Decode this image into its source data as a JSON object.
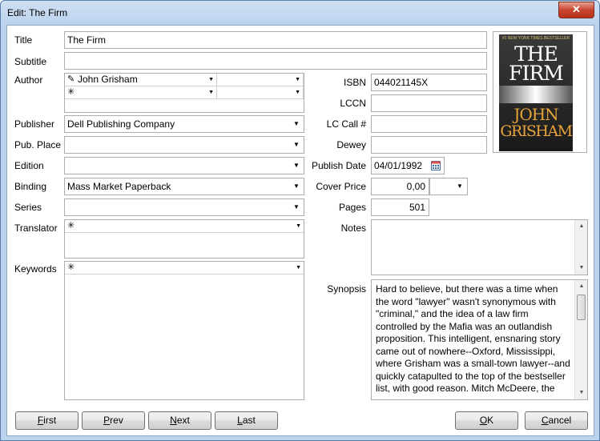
{
  "window": {
    "title": "Edit: The Firm",
    "close_glyph": "✕"
  },
  "labels": {
    "title": "Title",
    "subtitle": "Subtitle",
    "author": "Author",
    "publisher": "Publisher",
    "pub_place": "Pub. Place",
    "edition": "Edition",
    "binding": "Binding",
    "series": "Series",
    "translator": "Translator",
    "keywords": "Keywords",
    "isbn": "ISBN",
    "lccn": "LCCN",
    "lc_call": "LC Call #",
    "dewey": "Dewey",
    "publish_date": "Publish Date",
    "cover_price": "Cover Price",
    "pages": "Pages",
    "notes": "Notes",
    "synopsis": "Synopsis"
  },
  "values": {
    "title": "The Firm",
    "subtitle": "",
    "author_1": "John Grisham",
    "author_2": "",
    "publisher": "Dell Publishing Company",
    "pub_place": "",
    "edition": "",
    "binding": "Mass Market Paperback",
    "series": "",
    "translator": "",
    "keywords": "",
    "isbn": "044021145X",
    "lccn": "",
    "lc_call": "",
    "dewey": "",
    "publish_date": "04/01/1992",
    "cover_price": "0,00",
    "currency": "",
    "pages": "501",
    "notes": "",
    "synopsis": "Hard to believe, but there was a time when\nthe word \"lawyer\"  wasn't synonymous with\n\"criminal,\" and the idea of a law firm\ncontrolled by the Mafia was an outlandish\nproposition. This  intelligent, ensnaring story\ncame out of nowhere--Oxford, Mississippi,\nwhere Grisham was a small-town lawyer--and\nquickly catapulted to the  top of the bestseller\nlist, with good reason.  Mitch McDeere, the"
  },
  "glyphs": {
    "pencil": "✎",
    "star": "✳",
    "down": "▼",
    "up": "▲",
    "calendar": "calendar-icon"
  },
  "cover": {
    "top_text": "#1 NEW YORK TIMES BESTSELLER",
    "title_line1": "THE",
    "title_line2": "FIRM",
    "author_line1": "JOHN",
    "author_line2": "GRISHAM"
  },
  "buttons": {
    "first_u": "F",
    "first_rest": "irst",
    "prev_u": "P",
    "prev_rest": "rev",
    "next_u": "N",
    "next_rest": "ext",
    "last_u": "L",
    "last_rest": "ast",
    "ok_u": "O",
    "ok_rest": "K",
    "cancel_u": "C",
    "cancel_rest": "ancel"
  }
}
